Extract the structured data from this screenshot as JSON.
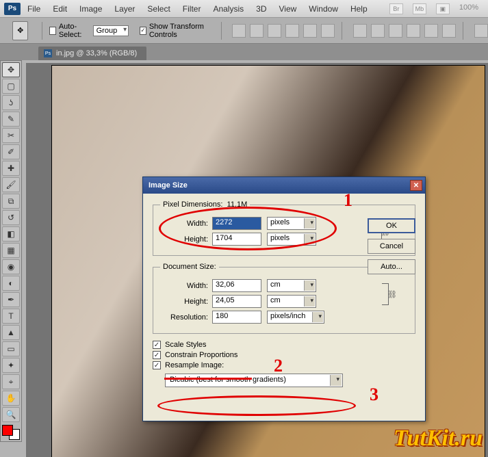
{
  "app": {
    "logo": "Ps"
  },
  "menu": [
    "File",
    "Edit",
    "Image",
    "Layer",
    "Select",
    "Filter",
    "Analysis",
    "3D",
    "View",
    "Window",
    "Help"
  ],
  "topright": {
    "zoom": "100%"
  },
  "options": {
    "autoselect_label": "Auto-Select:",
    "autoselect_value": "Group",
    "show_transform": "Show Transform Controls"
  },
  "doctab": {
    "title": "in.jpg @ 33,3% (RGB/8)"
  },
  "dialog": {
    "title": "Image Size",
    "pixel_dim_legend": "Pixel Dimensions:",
    "pixel_dim_size": "11,1M",
    "pixel": {
      "width_label": "Width:",
      "width_value": "2272",
      "width_unit": "pixels",
      "height_label": "Height:",
      "height_value": "1704",
      "height_unit": "pixels"
    },
    "doc_legend": "Document Size:",
    "doc": {
      "width_label": "Width:",
      "width_value": "32,06",
      "width_unit": "cm",
      "height_label": "Height:",
      "height_value": "24,05",
      "height_unit": "cm",
      "res_label": "Resolution:",
      "res_value": "180",
      "res_unit": "pixels/inch"
    },
    "scale_styles": "Scale Styles",
    "constrain": "Constrain Proportions",
    "resample": "Resample Image:",
    "method": "Bicubic (best for smooth gradients)",
    "buttons": {
      "ok": "OK",
      "cancel": "Cancel",
      "auto": "Auto..."
    }
  },
  "annotations": {
    "a1": "1",
    "a2": "2",
    "a3": "3"
  },
  "watermark": "TutKit.ru"
}
